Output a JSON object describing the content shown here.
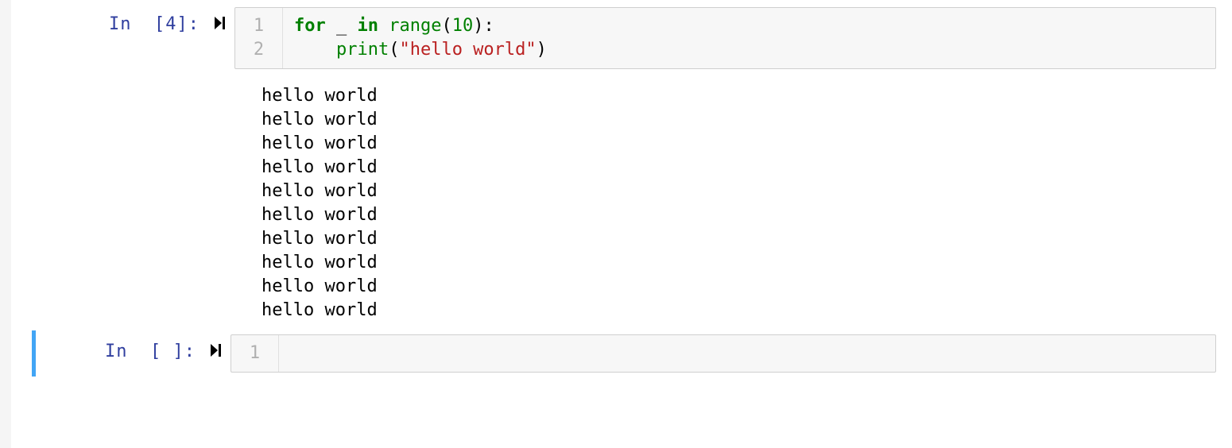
{
  "cells": [
    {
      "prompt_label": "In  [4]:",
      "selected": false,
      "line_numbers": [
        "1",
        "2"
      ],
      "code_tokens": [
        [
          {
            "t": "for",
            "c": "tok-keyword"
          },
          {
            "t": " _ ",
            "c": "tok-name"
          },
          {
            "t": "in",
            "c": "tok-keyword"
          },
          {
            "t": " ",
            "c": "tok-name"
          },
          {
            "t": "range",
            "c": "tok-builtin"
          },
          {
            "t": "(",
            "c": "tok-punct"
          },
          {
            "t": "10",
            "c": "tok-num"
          },
          {
            "t": "):",
            "c": "tok-punct"
          }
        ],
        [
          {
            "t": "    ",
            "c": "tok-name"
          },
          {
            "t": "print",
            "c": "tok-builtin"
          },
          {
            "t": "(",
            "c": "tok-punct"
          },
          {
            "t": "\"hello world\"",
            "c": "tok-string"
          },
          {
            "t": ")",
            "c": "tok-punct"
          }
        ]
      ],
      "output_lines": [
        "hello world",
        "hello world",
        "hello world",
        "hello world",
        "hello world",
        "hello world",
        "hello world",
        "hello world",
        "hello world",
        "hello world"
      ]
    },
    {
      "prompt_label": "In  [ ]:",
      "selected": true,
      "line_numbers": [
        "1"
      ],
      "code_tokens": [
        []
      ],
      "output_lines": []
    }
  ]
}
